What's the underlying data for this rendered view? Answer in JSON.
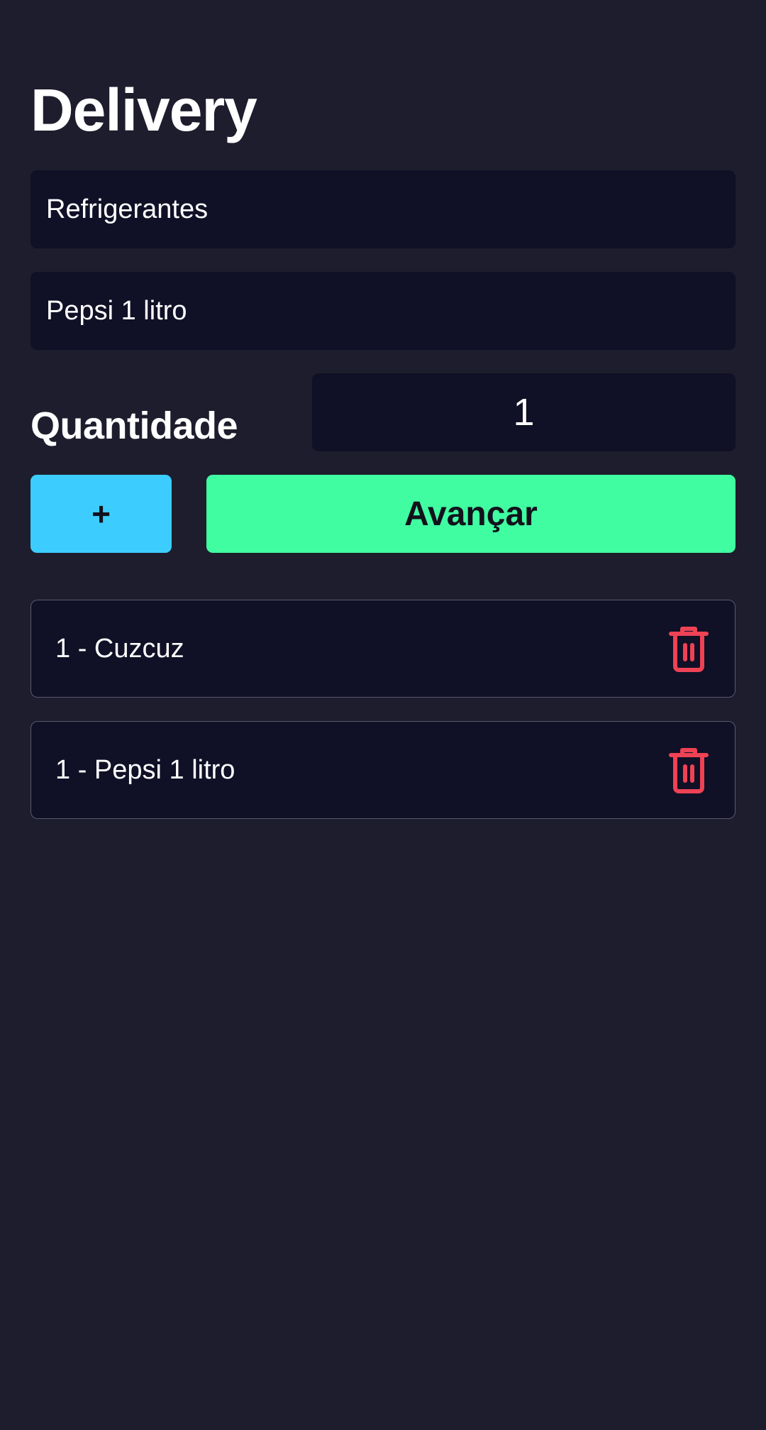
{
  "header": {
    "title": "Delivery"
  },
  "form": {
    "category_value": "Refrigerantes",
    "product_value": "Pepsi 1 litro",
    "quantity_label": "Quantidade",
    "quantity_value": "1",
    "add_label": "+",
    "next_label": "Avançar"
  },
  "order_items": [
    {
      "label": "1 - Cuzcuz",
      "icon": "trash-icon"
    },
    {
      "label": "1 - Pepsi 1 litro",
      "icon": "trash-icon"
    }
  ],
  "colors": {
    "background": "#1e1d2d",
    "field": "#101026",
    "add_button": "#3ccdfe",
    "next_button": "#40fda1",
    "delete_icon": "#ee4255"
  }
}
